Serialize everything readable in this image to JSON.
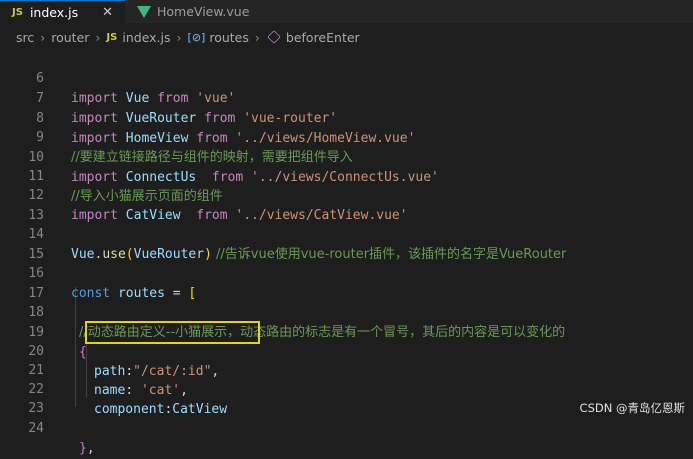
{
  "tabs": [
    {
      "icon": "JS",
      "label": "index.js",
      "close": "✕"
    },
    {
      "label": "HomeView.vue"
    }
  ],
  "breadcrumb": {
    "items": [
      "src",
      "router",
      "index.js",
      "routes",
      "beforeEnter"
    ],
    "js_icon": "JS",
    "routes_icon": "[⊘]"
  },
  "code": {
    "l6": {
      "n": "6",
      "t": [
        "import",
        " Vue ",
        "from",
        " 'vue'"
      ]
    },
    "l7": {
      "n": "7",
      "t": [
        "import",
        " VueRouter ",
        "from",
        " 'vue-router'"
      ]
    },
    "l8": {
      "n": "8",
      "t": [
        "import",
        " HomeView ",
        "from",
        " '../views/HomeView.vue'"
      ]
    },
    "l9": {
      "n": "9",
      "t": [
        "//要建立链接路径与组件的映射，需要把组件导入"
      ]
    },
    "l10": {
      "n": "10",
      "t": [
        "import",
        " ConnectUs  ",
        "from",
        " '../views/ConnectUs.vue'"
      ]
    },
    "l11": {
      "n": "11",
      "t": [
        "//导入小猫展示页面的组件"
      ]
    },
    "l12": {
      "n": "12",
      "t": [
        "import",
        " CatView  ",
        "from",
        " '../views/CatView.vue'"
      ]
    },
    "l13": {
      "n": "13"
    },
    "l14": {
      "n": "14",
      "t": [
        "Vue",
        ".",
        "use",
        "(",
        "VueRouter",
        ")",
        " //告诉vue使用vue-router插件，该插件的名字是VueRouter"
      ]
    },
    "l15": {
      "n": "15"
    },
    "l16": {
      "n": "16",
      "t": [
        "const",
        " ",
        "routes",
        " = ",
        "["
      ]
    },
    "l17": {
      "n": "17"
    },
    "l18": {
      "n": "18",
      "t": [
        "//动态路由定义--小猫展示，动态路由的标志是有一个冒号，其后的内容是可以变化的"
      ]
    },
    "l19": {
      "n": "19",
      "t": [
        "{"
      ]
    },
    "l20": {
      "n": "20",
      "t": [
        "path",
        ":",
        "\"/cat/:id\"",
        ","
      ]
    },
    "l21": {
      "n": "21",
      "t": [
        "name",
        ": ",
        "'cat'",
        ","
      ]
    },
    "l22": {
      "n": "22",
      "t": [
        "component",
        ":",
        "CatView"
      ]
    },
    "l23": {
      "n": "23"
    },
    "l24": {
      "n": "24",
      "t": [
        "}",
        ","
      ]
    }
  },
  "watermark": "CSDN @青岛亿恩斯",
  "colors": {
    "keyword": "#c586c0",
    "identifier": "#9cdcfe",
    "string": "#ce9178",
    "comment": "#6a9955",
    "highlight_box": "#e2d12b"
  }
}
